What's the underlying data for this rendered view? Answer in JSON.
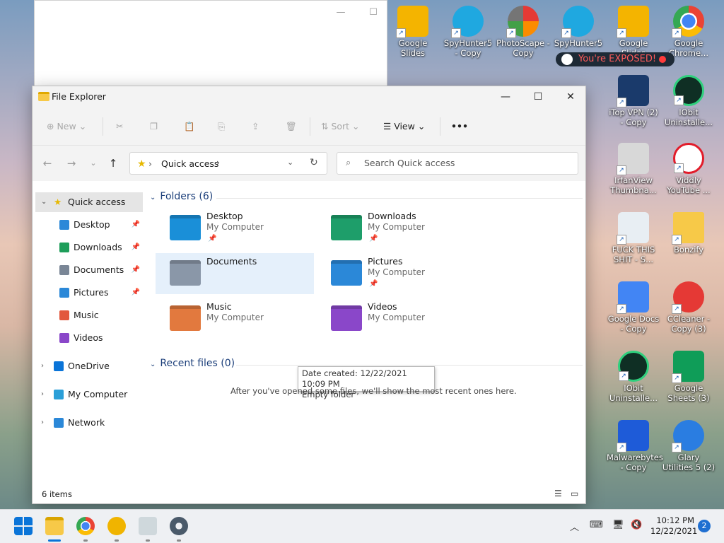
{
  "desktop": {
    "icons": [
      {
        "label": "Google Slides",
        "kind": "ic-slides"
      },
      {
        "label": "SpyHunter5 - Copy",
        "kind": "ic-spy"
      },
      {
        "label": "PhotoScape - Copy",
        "kind": "ic-photo"
      },
      {
        "label": "SpyHunter5",
        "kind": "ic-spy"
      },
      {
        "label": "Google Slides",
        "kind": "ic-slides"
      },
      {
        "label": "Google Chrome...",
        "kind": "ic-chrome"
      },
      {
        "label": "iTop VPN (2) - Copy",
        "kind": "ic-vpn"
      },
      {
        "label": "IObit Uninstalle...",
        "kind": "ic-iobit"
      },
      {
        "label": "IrfanView Thumbna...",
        "kind": "ic-panda"
      },
      {
        "label": "Viddly YouTube ...",
        "kind": "ic-viddly"
      },
      {
        "label": "FUCK THIS SHIT - S...",
        "kind": "ic-bin"
      },
      {
        "label": "Bonzify",
        "kind": "ic-folder"
      },
      {
        "label": "Google Docs - Copy",
        "kind": "ic-docs"
      },
      {
        "label": "CCleaner - Copy (3)",
        "kind": "ic-ccleaner"
      },
      {
        "label": "IObit Uninstalle...",
        "kind": "ic-iobit"
      },
      {
        "label": "Google Sheets (3)",
        "kind": "ic-sheets"
      },
      {
        "label": "Malwarebytes - Copy",
        "kind": "ic-malware"
      },
      {
        "label": "Glary Utilities 5 (2)",
        "kind": "ic-glary"
      }
    ],
    "exposed_label": "You're EXPOSED!"
  },
  "explorer": {
    "title": "File Explorer",
    "toolbar": {
      "new_label": "New",
      "sort_label": "Sort",
      "view_label": "View",
      "more_label": "•••"
    },
    "address": {
      "crumb": "Quick access",
      "search_placeholder": "Search Quick access"
    },
    "sidebar": [
      {
        "label": "Quick access",
        "icon": "star-icon",
        "color": "#e6b800"
      },
      {
        "label": "Desktop",
        "icon": "desktop-icon",
        "color": "#2b88d8"
      },
      {
        "label": "Downloads",
        "icon": "download-icon",
        "color": "#1e9e5a"
      },
      {
        "label": "Documents",
        "icon": "documents-icon",
        "color": "#7a8696"
      },
      {
        "label": "Pictures",
        "icon": "pictures-icon",
        "color": "#2b88d8"
      },
      {
        "label": "Music",
        "icon": "music-icon",
        "color": "#e2583e"
      },
      {
        "label": "Videos",
        "icon": "videos-icon",
        "color": "#8a47c9"
      },
      {
        "label": "OneDrive",
        "icon": "cloud-icon",
        "color": "#0a74d8"
      },
      {
        "label": "My Computer",
        "icon": "computer-icon",
        "color": "#2b9fd8"
      },
      {
        "label": "Network",
        "icon": "network-icon",
        "color": "#2b88d8"
      }
    ],
    "folders_header": "Folders (6)",
    "folders": [
      {
        "name": "Desktop",
        "location": "My Computer",
        "color": "#1a8fd8"
      },
      {
        "name": "Downloads",
        "location": "My Computer",
        "color": "#1e9e6a"
      },
      {
        "name": "Documents",
        "location": "",
        "color": "#8a97a8"
      },
      {
        "name": "Pictures",
        "location": "My Computer",
        "color": "#2b88d8"
      },
      {
        "name": "Music",
        "location": "My Computer",
        "color": "#e2793e"
      },
      {
        "name": "Videos",
        "location": "My Computer",
        "color": "#8a47c9"
      }
    ],
    "tooltip": {
      "line1": "Date created: 12/22/2021 10:09 PM",
      "line2": "Empty folder"
    },
    "recent_header": "Recent files (0)",
    "recent_empty": "After you've opened some files, we'll show the most recent ones here.",
    "status_count": "6 items"
  },
  "taskbar": {
    "time": "10:12 PM",
    "date": "12/22/2021",
    "notifications": "2"
  }
}
